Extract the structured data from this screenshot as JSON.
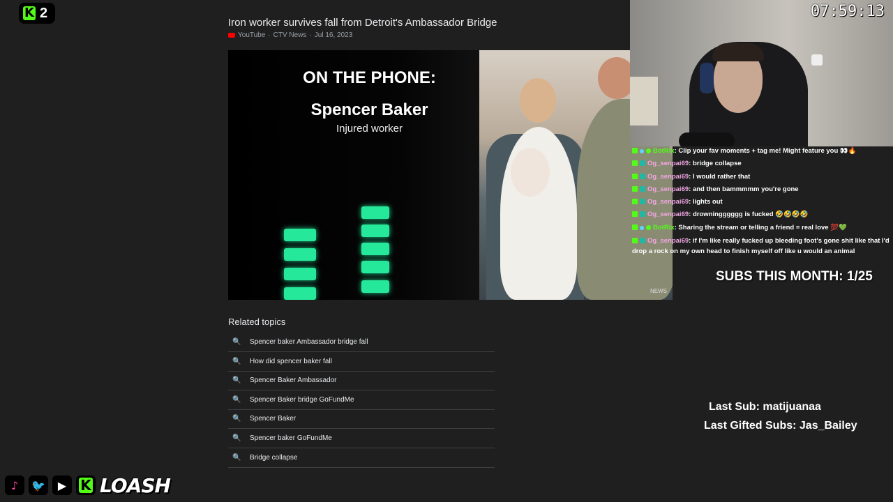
{
  "kick_badge": {
    "count": "2"
  },
  "article": {
    "title": "Iron worker survives fall from Detroit's Ambassador Bridge",
    "source": "YouTube",
    "channel": "CTV News",
    "date": "Jul 16, 2023",
    "separator": "·"
  },
  "video": {
    "heading": "ON THE PHONE:",
    "name": "Spencer Baker",
    "role": "Injured worker",
    "corner_logo": "NEWS"
  },
  "related": {
    "title": "Related topics",
    "topics": [
      "Spencer baker Ambassador bridge fall",
      "How did spencer baker fall",
      "Spencer Baker Ambassador",
      "Spencer Baker bridge GoFundMe",
      "Spencer Baker",
      "Spencer baker GoFundMe",
      "Bridge collapse"
    ]
  },
  "stream": {
    "timer": "07:59:13",
    "subs_month": "SUBS THIS MONTH: 1/25",
    "last_sub": "Last Sub: matijuanaa",
    "last_gifted": "Last Gifted Subs: Jas_Bailey",
    "brand": "LOASH"
  },
  "chat": [
    {
      "user": "BotRix",
      "type": "bot",
      "message": ": Clip your fav moments + tag me! Might feature you 👀🔥"
    },
    {
      "user": "Og_senpai69",
      "type": "og",
      "message": ": bridge collapse"
    },
    {
      "user": "Og_senpai69",
      "type": "og",
      "message": ": I would rather that"
    },
    {
      "user": "Og_senpai69",
      "type": "og",
      "message": ": and then bammmmm you're gone"
    },
    {
      "user": "Og_senpai69",
      "type": "og",
      "message": ": lights out"
    },
    {
      "user": "Og_senpai69",
      "type": "og",
      "message": ": drowningggggg is fucked 🤣🤣🤣🤣"
    },
    {
      "user": "BotRix",
      "type": "bot",
      "message": ": Sharing the stream or telling a friend = real love 💯💚"
    },
    {
      "user": "Og_senpai69",
      "type": "og",
      "message": ": if I'm like really fucked up bleeding foot's gone shit like that I'd drop a rock on my own head to finish myself off like u would an animal"
    }
  ],
  "colors": {
    "kick_green": "#53fc18",
    "eq_green": "#26e89a",
    "background": "#1f1f1f"
  }
}
